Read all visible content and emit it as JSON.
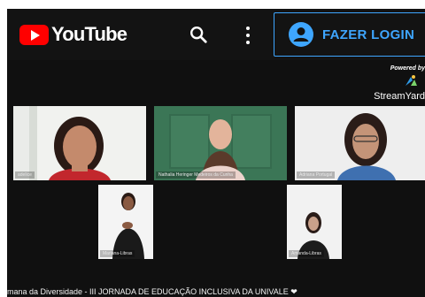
{
  "header": {
    "logo_text": "YouTube",
    "login_label": "FAZER LOGIN",
    "accent_color": "#3ea6ff",
    "brand_color": "#ff0000"
  },
  "powered_by": {
    "label": "Powered by",
    "brand": "StreamYard"
  },
  "participants": [
    {
      "name": "adelice"
    },
    {
      "name": "Nathalia Heringer Medeiros da Cunha"
    },
    {
      "name": "Adriana Portugal"
    },
    {
      "name": "Mariana-Libras"
    },
    {
      "name": "Amanda-Libras"
    }
  ],
  "ticker": "mana da Diversidade - III JORNADA DE EDUCAÇÃO INCLUSIVA DA UNIVALE ❤"
}
